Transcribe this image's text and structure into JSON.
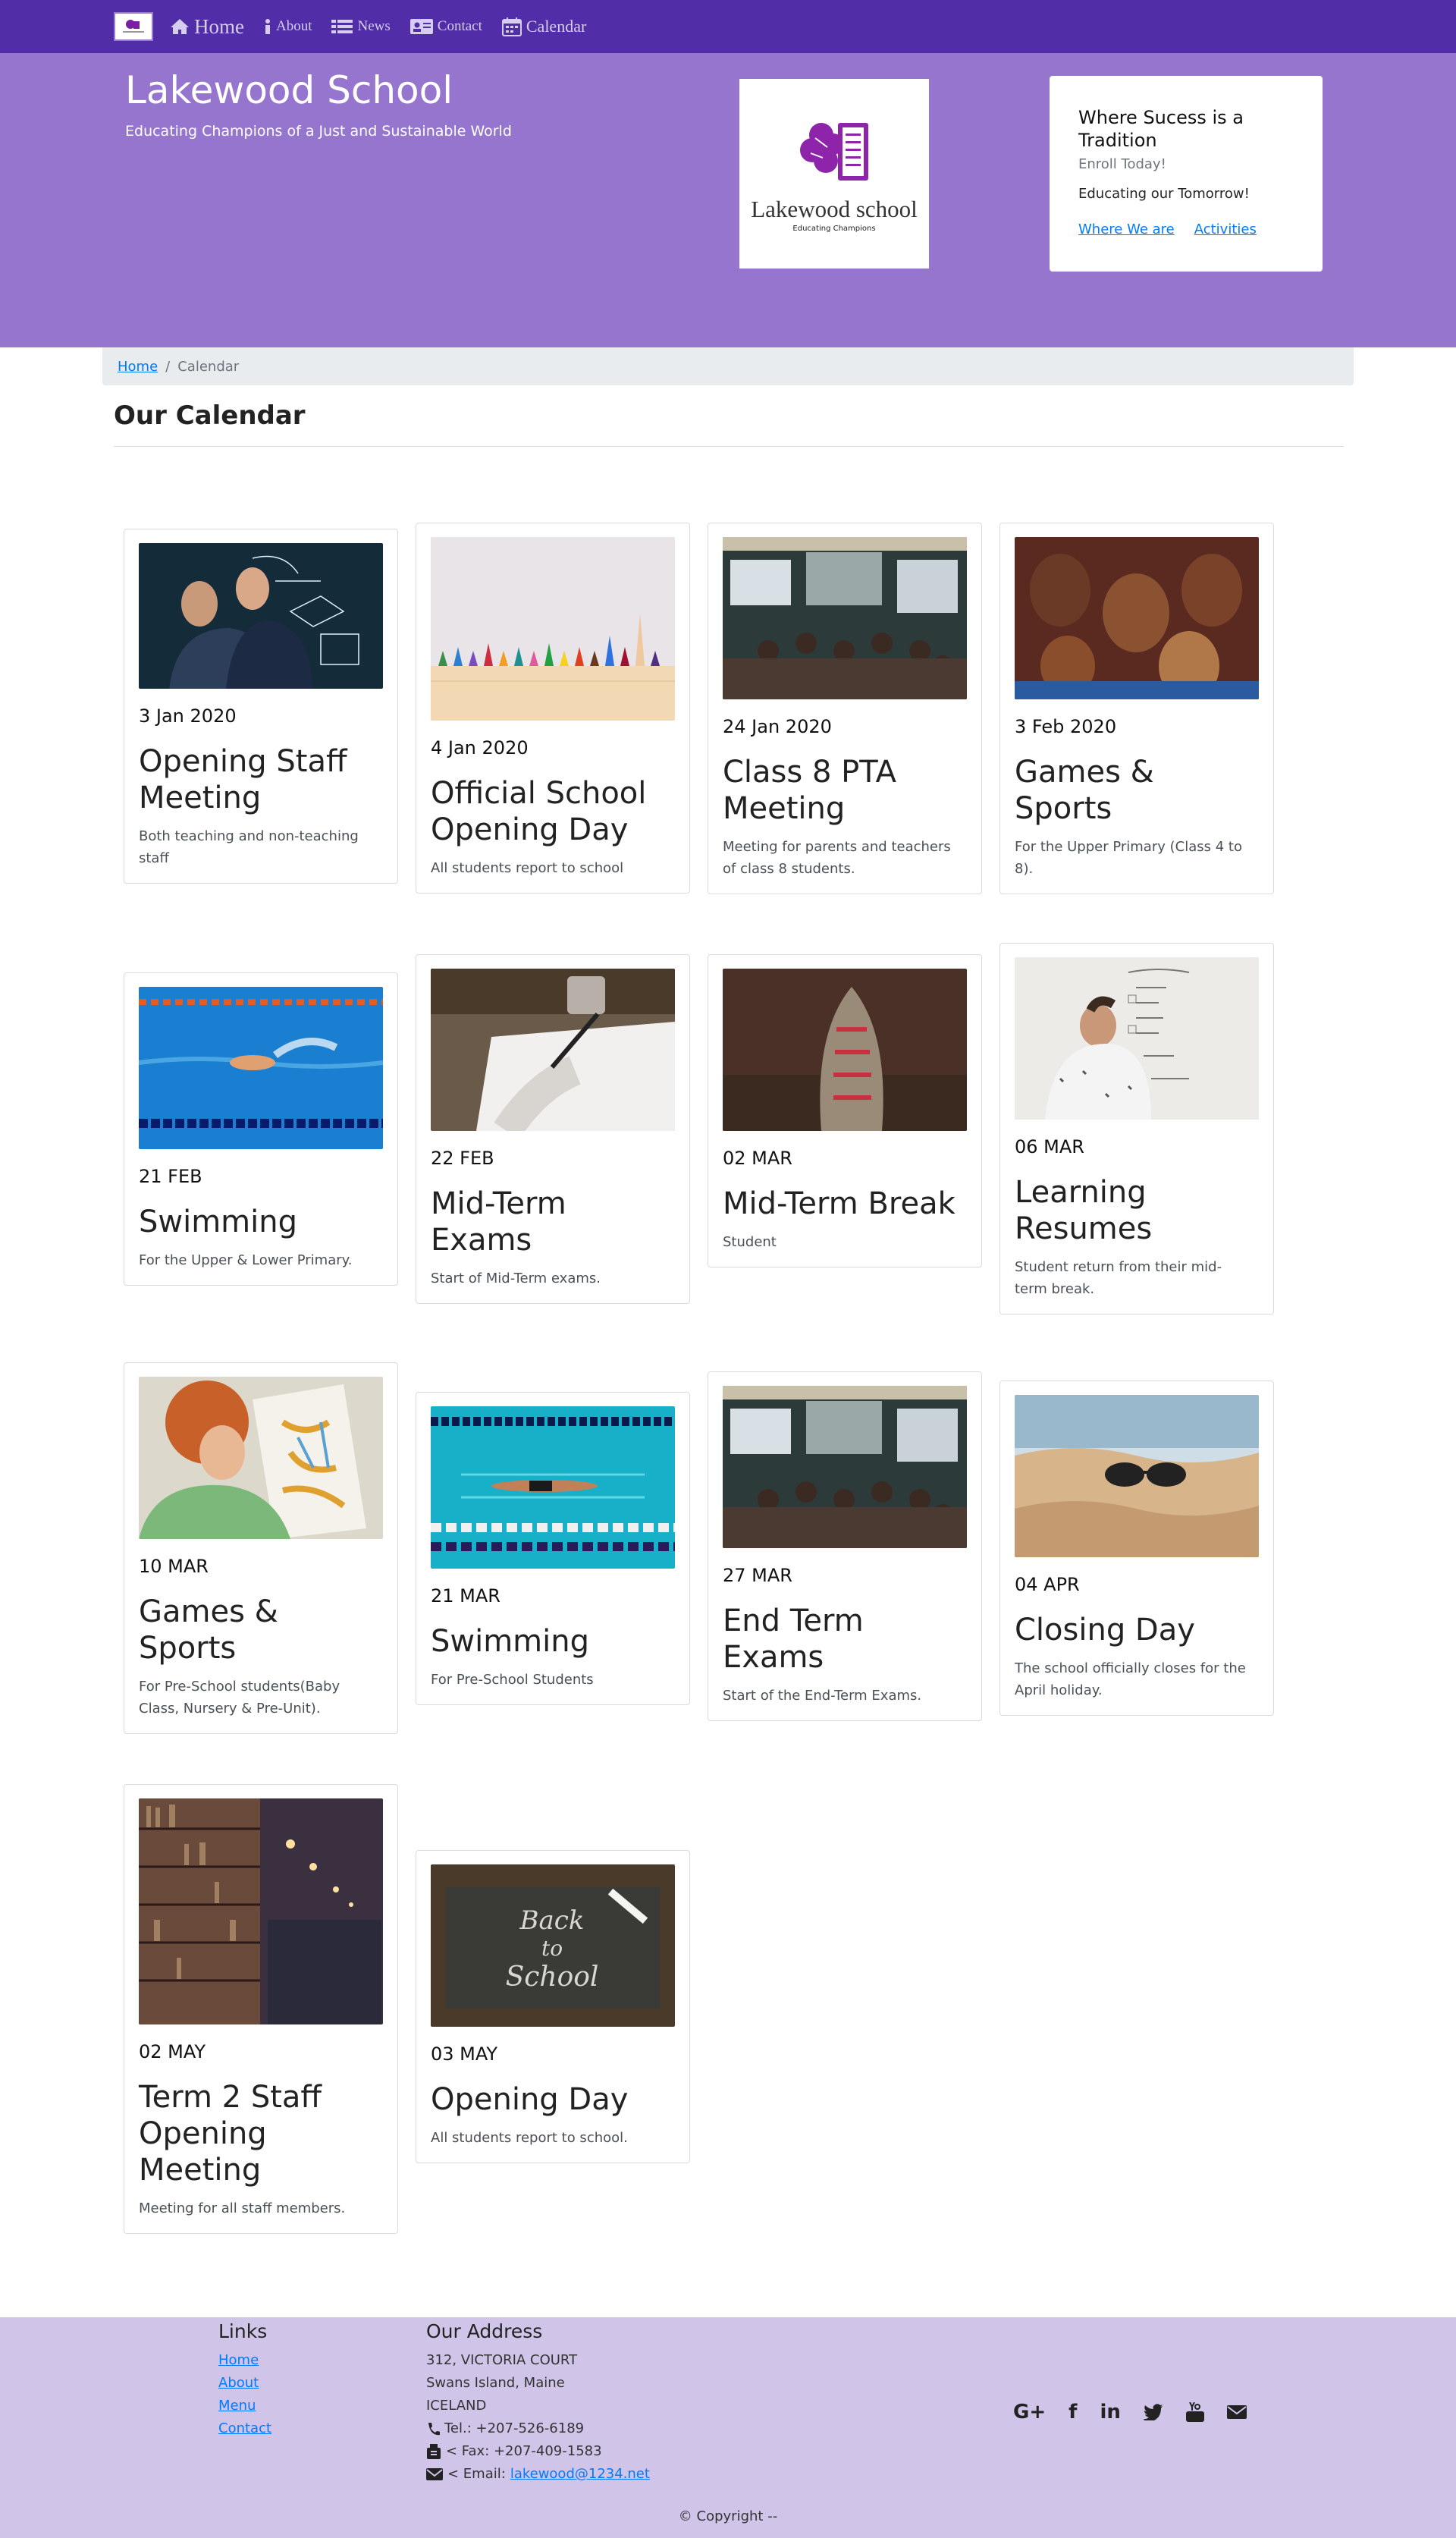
{
  "navbar": {
    "items": [
      {
        "label": "Home",
        "icon": "home-icon"
      },
      {
        "label": "About",
        "icon": "info-icon"
      },
      {
        "label": "News",
        "icon": "list-icon"
      },
      {
        "label": "Contact",
        "icon": "address-card-icon"
      },
      {
        "label": "Calendar",
        "icon": "calendar-icon"
      }
    ]
  },
  "header": {
    "school_name": "Lakewood School",
    "motto": "Educating Champions of a Just and Sustainable World",
    "logo_name": "Lakewood school",
    "logo_tagline": "Educating Champions",
    "info": {
      "title": "Where Sucess is a Tradition",
      "subtitle": "Enroll Today!",
      "text": "Educating our Tomorrow!",
      "link1": "Where We are",
      "link2": "Activities"
    }
  },
  "breadcrumb": {
    "home": "Home",
    "separator": "/",
    "current": "Calendar"
  },
  "page_title": "Our Calendar",
  "events": [
    {
      "date": "3 Jan 2020",
      "title": "Opening Staff Meeting",
      "text": "Both teaching and non-teaching staff",
      "image": "teachers at chalkboard"
    },
    {
      "date": "4 Jan 2020",
      "title": "Official School Opening Day",
      "text": "All students report to school",
      "image": "colored pencils"
    },
    {
      "date": "24 Jan 2020",
      "title": "Class 8 PTA Meeting",
      "text": "Meeting for parents and teachers of class 8 students.",
      "image": "classroom meeting"
    },
    {
      "date": "3 Feb 2020",
      "title": "Games & Sports",
      "text": "For the Upper Primary (Class 4 to 8).",
      "image": "smiling children"
    },
    {
      "date": "21 FEB",
      "title": "Swimming",
      "text": "For the Upper & Lower Primary.",
      "image": "swimmer in pool"
    },
    {
      "date": "22 FEB",
      "title": "Mid-Term Exams",
      "text": "Start of Mid-Term exams.",
      "image": "writing exam"
    },
    {
      "date": "02 MAR",
      "title": "Mid-Term Break",
      "text": "Student",
      "image": "do not open bag"
    },
    {
      "date": "06 MAR",
      "title": "Learning Resumes",
      "text": "Student return from their mid-term break.",
      "image": "man at whiteboard"
    },
    {
      "date": "10 MAR",
      "title": "Games & Sports",
      "text": "For Pre-School students(Baby Class, Nursery & Pre-Unit).",
      "image": "child with map"
    },
    {
      "date": "21 MAR",
      "title": "Swimming",
      "text": "For Pre-School Students",
      "image": "swimmer underwater"
    },
    {
      "date": "27 MAR",
      "title": "End Term Exams",
      "text": "Start of the End-Term Exams.",
      "image": "classroom meeting"
    },
    {
      "date": "04 APR",
      "title": "Closing Day",
      "text": "The school officially closes for the April holiday.",
      "image": "sunglasses on sand"
    },
    {
      "date": "02 MAY",
      "title": "Term 2 Staff Opening Meeting",
      "text": "Meeting for all staff members.",
      "image": "library shelves"
    },
    {
      "date": "03 MAY",
      "title": "Opening Day",
      "text": "All students report to school.",
      "image": "back to school chalkboard"
    }
  ],
  "footer": {
    "links_heading": "Links",
    "links": [
      "Home",
      "About",
      "Menu",
      "Contact"
    ],
    "address_heading": "Our Address",
    "address": [
      "312, VICTORIA COURT",
      "Swans Island, Maine",
      "ICELAND"
    ],
    "tel": "Tel.: +207-526-6189",
    "fax": "< Fax: +207-409-1583",
    "email_label": "< Email:",
    "email": "lakewood@1234.net",
    "socials": [
      "google-plus-icon",
      "facebook-icon",
      "linkedin-icon",
      "twitter-icon",
      "youtube-icon",
      "envelope-icon"
    ],
    "copyright": "© Copyright --"
  }
}
